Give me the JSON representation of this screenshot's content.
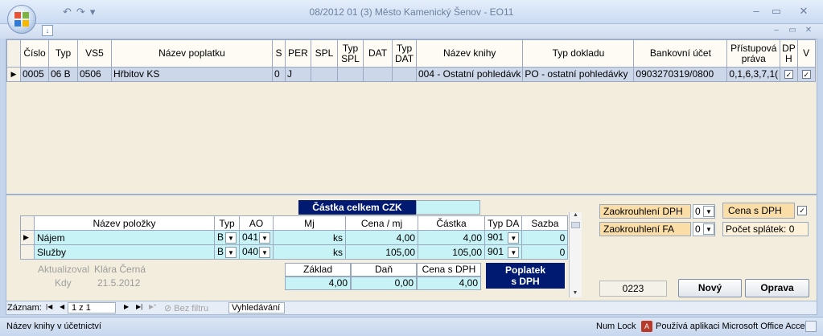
{
  "window": {
    "title": "08/2012   01  (3)  Město Kamenický Šenov  -  EO11",
    "qat": {
      "undo": "↶",
      "redo": "↷",
      "customize": "▾"
    },
    "controls": {
      "minimize": "‒",
      "restore": "▭",
      "close": "✕"
    },
    "inner_controls": {
      "minimize": "‒",
      "restore": "▭",
      "close": "✕"
    }
  },
  "grid": {
    "columns": [
      "Číslo",
      "Typ",
      "VS5",
      "Název poplatku",
      "S",
      "PER",
      "SPL",
      "Typ SPL",
      "DAT",
      "Typ DAT",
      "Název knihy",
      "Typ dokladu",
      "Bankovní účet",
      "Přístupová práva",
      "DP H",
      "V"
    ],
    "row": {
      "selector": "▶",
      "cislo": "0005",
      "typ": "06  B",
      "vs5": "0506",
      "nazev": "Hřbitov KS",
      "s": "0",
      "per": "J",
      "spl": "",
      "typ_spl": "",
      "dat": "",
      "typ_dat": "",
      "kniha": "004 -  Ostatní pohledávk",
      "doklad": "PO - ostatní pohledávky",
      "ucet": "0903270319/0800",
      "prava": "0,1,6,3,7,1(",
      "dph": "✓",
      "v": "✓"
    }
  },
  "detail": {
    "castka_celkem_label": "Částka celkem CZK",
    "castka_celkem_value": "",
    "columns": [
      "Název položky",
      "Typ",
      "AO",
      "Mj",
      "Cena / mj",
      "Částka",
      "Typ DA",
      "Sazba"
    ],
    "rows": [
      {
        "selector": "▶",
        "nazev": "Nájem",
        "typ": "B",
        "ao": "041",
        "mj": "ks",
        "cena": "4,00",
        "castka": "4,00",
        "typda": "901",
        "sazba": "0"
      },
      {
        "selector": "",
        "nazev": "Služby",
        "typ": "B",
        "ao": "040",
        "mj": "ks",
        "cena": "105,00",
        "castka": "105,00",
        "typda": "901",
        "sazba": "0"
      }
    ],
    "aktualizoval_label": "Aktualizoval",
    "aktualizoval_value": "Klára Černá",
    "kdy_label": "Kdy",
    "kdy_value": "21.5.2012",
    "totals_headers": [
      "Základ",
      "Daň",
      "Cena s DPH"
    ],
    "totals_values": [
      "4,00",
      "0,00",
      "4,00"
    ],
    "poplatek_label": "Poplatek\ns DPH",
    "zaokrouhleni_dph_label": "Zaokrouhlení  DPH",
    "zaokrouhleni_dph_value": "0",
    "zaokrouhleni_fa_label": "Zaokrouhlení  FA",
    "zaokrouhleni_fa_value": "0",
    "cena_s_dph_label": "Cena  s  DPH",
    "cena_s_dph_checked": "✓",
    "pocet_splatek_label": "Počet splátek: 0",
    "code_value": "0223",
    "novy_label": "Nový",
    "oprava_label": "Oprava"
  },
  "nav": {
    "zaznam_label": "Záznam:",
    "first": "|◀",
    "prev": "◀",
    "position": "1 z 1",
    "next": "▶",
    "last": "▶|",
    "new": "▶*",
    "filter": "Bez filtru",
    "search": "Vyhledávání"
  },
  "status": {
    "left": "Název knihy v účetnictví",
    "numlock": "Num Lock",
    "access": "Používá aplikaci Microsoft Office Access"
  }
}
